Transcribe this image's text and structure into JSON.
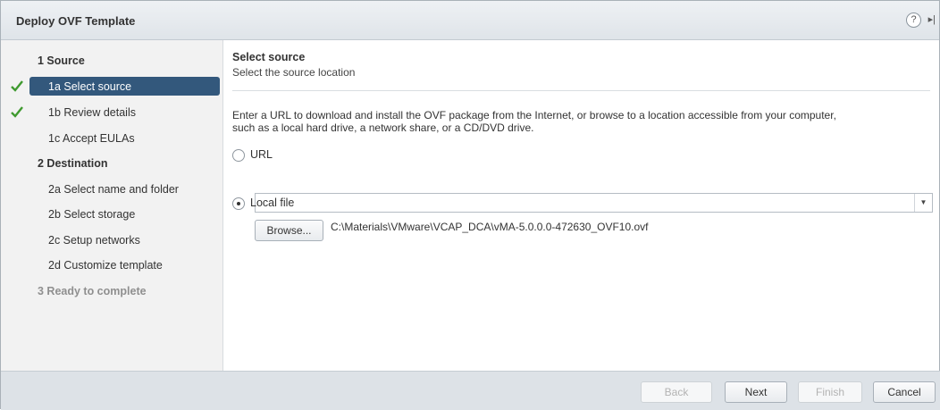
{
  "window": {
    "title": "Deploy OVF Template"
  },
  "sidebar": {
    "steps": [
      {
        "label": "1 Source",
        "kind": "section",
        "completed": false,
        "selected": false
      },
      {
        "label": "1a Select source",
        "kind": "substep",
        "completed": true,
        "selected": true
      },
      {
        "label": "1b Review details",
        "kind": "substep",
        "completed": true,
        "selected": false
      },
      {
        "label": "1c Accept EULAs",
        "kind": "substep",
        "completed": false,
        "selected": false
      },
      {
        "label": "2 Destination",
        "kind": "section",
        "completed": false,
        "selected": false
      },
      {
        "label": "2a Select name and folder",
        "kind": "substep",
        "completed": false,
        "selected": false
      },
      {
        "label": "2b Select storage",
        "kind": "substep",
        "completed": false,
        "selected": false
      },
      {
        "label": "2c Setup networks",
        "kind": "substep",
        "completed": false,
        "selected": false
      },
      {
        "label": "2d Customize template",
        "kind": "substep",
        "completed": false,
        "selected": false
      },
      {
        "label": "3 Ready to complete",
        "kind": "section-disabled",
        "completed": false,
        "selected": false
      }
    ]
  },
  "main": {
    "heading": "Select source",
    "subheading": "Select the source location",
    "description_line1": "Enter a URL to download and install the OVF package from the Internet, or browse to a location accessible from your computer,",
    "description_line2": "such as a local hard drive, a network share, or a CD/DVD drive.",
    "url_option": {
      "label": "URL",
      "checked": false,
      "value": ""
    },
    "local_option": {
      "label": "Local file",
      "checked": true
    },
    "browse_label": "Browse...",
    "file_path": "C:\\Materials\\VMware\\VCAP_DCA\\vMA-5.0.0.0-472630_OVF10.ovf"
  },
  "footer": {
    "back_label": "Back",
    "next_label": "Next",
    "finish_label": "Finish",
    "cancel_label": "Cancel"
  },
  "colors": {
    "selected_step": "#33587c",
    "check": "#3f9a2f"
  }
}
